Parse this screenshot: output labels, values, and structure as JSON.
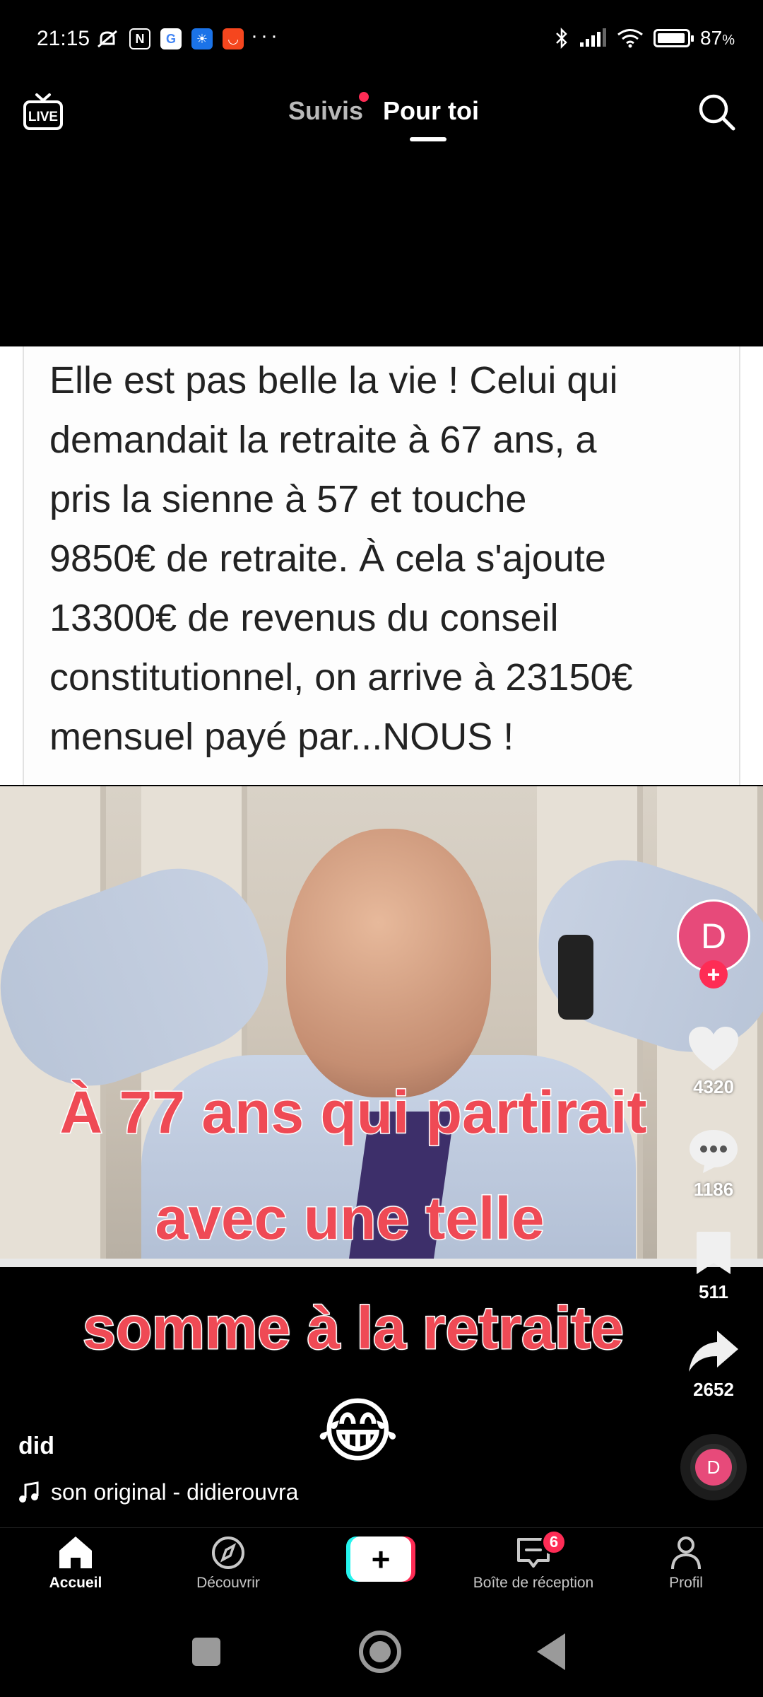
{
  "status_bar": {
    "time": "21:15",
    "dots": "···",
    "battery": "87",
    "battery_unit": "%",
    "icons": [
      "mute-icon",
      "nfc-icon",
      "google-icon",
      "weather-icon",
      "shop-icon",
      "bluetooth-icon",
      "signal-icon",
      "wifi-icon",
      "battery-icon"
    ]
  },
  "top_nav": {
    "live_label": "LIVE",
    "tabs": [
      {
        "label": "Suivis",
        "active": false,
        "has_dot": true
      },
      {
        "label": "Pour toi",
        "active": true
      }
    ]
  },
  "video": {
    "post_text_lines": [
      "Elle est pas belle la vie ! Celui qui",
      "demandait la retraite à 67 ans, a",
      "pris la sienne à 57 et touche",
      "9850€ de retraite. À cela s'ajoute",
      "13300€ de revenus du conseil",
      "constitutionnel, on arrive à 23150€",
      "mensuel payé par...NOUS !"
    ],
    "captions": [
      "À 77 ans qui partirait",
      "avec une telle",
      "somme à la retraite"
    ],
    "emoji": "😂",
    "caption_color": "#ef4a55"
  },
  "actions": {
    "avatar_letter": "D",
    "follow_symbol": "+",
    "likes": "4320",
    "comments": "1186",
    "saves": "511",
    "shares": "2652",
    "music_disc_letter": "D"
  },
  "author": {
    "name": "did",
    "music": "son original - didierouvra"
  },
  "bottom_nav": {
    "items": [
      {
        "label": "Accueil",
        "icon": "home-icon",
        "active": true
      },
      {
        "label": "Découvrir",
        "icon": "compass-icon",
        "active": false
      },
      {
        "label": "+",
        "icon": "create-icon"
      },
      {
        "label": "Boîte de réception",
        "icon": "inbox-icon",
        "badge": "6"
      },
      {
        "label": "Profil",
        "icon": "profile-icon"
      }
    ]
  },
  "colors": {
    "accent": "#fe2c55",
    "cyan": "#25f4ee",
    "avatar": "#e74a7a"
  }
}
